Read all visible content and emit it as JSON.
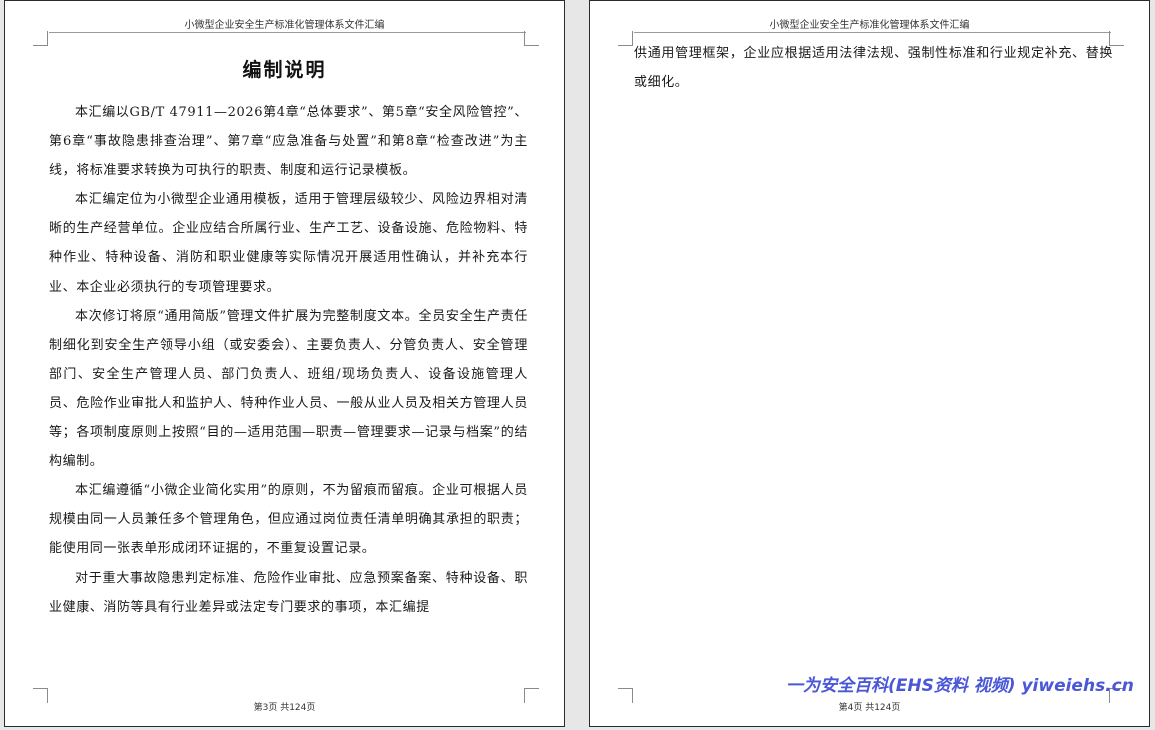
{
  "header_text": "小微型企业安全生产标准化管理体系文件汇编",
  "left_page": {
    "title": "编制说明",
    "paragraphs": [
      "本汇编以GB/T 47911—2026第4章“总体要求”、第5章“安全风险管控”、第6章“事故隐患排查治理”、第7章“应急准备与处置”和第8章“检查改进”为主线，将标准要求转换为可执行的职责、制度和运行记录模板。",
      "本汇编定位为小微型企业通用模板，适用于管理层级较少、风险边界相对清晰的生产经营单位。企业应结合所属行业、生产工艺、设备设施、危险物料、特种作业、特种设备、消防和职业健康等实际情况开展适用性确认，并补充本行业、本企业必须执行的专项管理要求。",
      "本次修订将原“通用简版”管理文件扩展为完整制度文本。全员安全生产责任制细化到安全生产领导小组（或安委会）、主要负责人、分管负责人、安全管理部门、安全生产管理人员、部门负责人、班组/现场负责人、设备设施管理人员、危险作业审批人和监护人、特种作业人员、一般从业人员及相关方管理人员等；各项制度原则上按照“目的—适用范围—职责—管理要求—记录与档案”的结构编制。",
      "本汇编遵循“小微企业简化实用”的原则，不为留痕而留痕。企业可根据人员规模由同一人员兼任多个管理角色，但应通过岗位责任清单明确其承担的职责；能使用同一张表单形成闭环证据的，不重复设置记录。",
      "对于重大事故隐患判定标准、危险作业审批、应急预案备案、特种设备、职业健康、消防等具有行业差异或法定专门要求的事项，本汇编提"
    ],
    "footer": "第3页 共124页"
  },
  "right_page": {
    "continuation": "供通用管理框架，企业应根据适用法律法规、强制性标准和行业规定补充、替换或细化。",
    "footer": "第4页 共124页"
  },
  "watermark": "一为安全百科(EHS资料 视频) yiweiehs.cn"
}
